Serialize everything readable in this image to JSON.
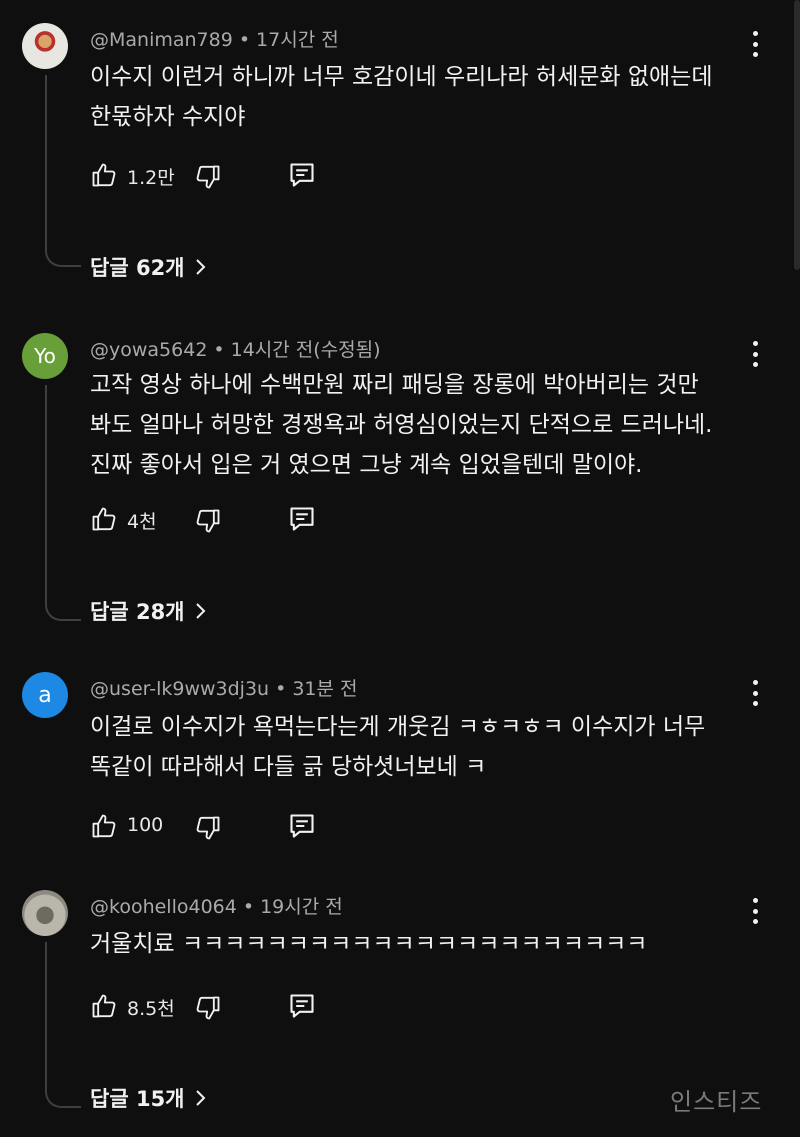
{
  "comments": [
    {
      "author": "@Maniman789",
      "time": "17시간 전",
      "avatar_label": "",
      "lines": [
        "이수지 이런거 하니까 너무 호감이네 우리나라 허세문화 없애는데",
        "한몫하자 수지야"
      ],
      "likes": "1.2만",
      "replies": "답글 62개"
    },
    {
      "author": "@yowa5642",
      "time": "14시간 전(수정됨)",
      "avatar_label": "Yo",
      "lines": [
        "고작 영상 하나에 수백만원 짜리 패딩을 장롱에 박아버리는 것만",
        "봐도 얼마나 허망한 경쟁욕과 허영심이었는지 단적으로 드러나네.",
        "진짜 좋아서 입은 거 였으면 그냥 계속 입었을텐데 말이야."
      ],
      "likes": "4천",
      "replies": "답글 28개"
    },
    {
      "author": "@user-lk9ww3dj3u",
      "time": "31분 전",
      "avatar_label": "a",
      "lines": [
        "이걸로 이수지가 욕먹는다는게 개웃김 ㅋㅎㅋㅎㅋ 이수지가 너무",
        "똑같이 따라해서 다들 긁 당하셧너보네 ㅋ"
      ],
      "likes": "100",
      "replies": ""
    },
    {
      "author": "@koohello4064",
      "time": "19시간 전",
      "avatar_label": "",
      "lines": [
        "거울치료 ㅋㅋㅋㅋㅋㅋㅋㅋㅋㅋㅋㅋㅋㅋㅋㅋㅋㅋㅋㅋㅋㅋ"
      ],
      "likes": "8.5천",
      "replies": "답글 15개"
    }
  ],
  "separator": "•",
  "watermark": "인스티즈",
  "icons": {
    "more": "more-vert-icon",
    "like": "thumb-up-icon",
    "dislike": "thumb-down-icon",
    "reply": "reply-comment-icon",
    "chevron": "chevron-right-icon"
  },
  "colors": {
    "background": "#0f0f0f",
    "text": "#f1f1f1",
    "meta": "#aaaaaa",
    "thread_line": "#3f3f3f",
    "avatar_green": "#689f38",
    "avatar_blue": "#1e88e5"
  }
}
